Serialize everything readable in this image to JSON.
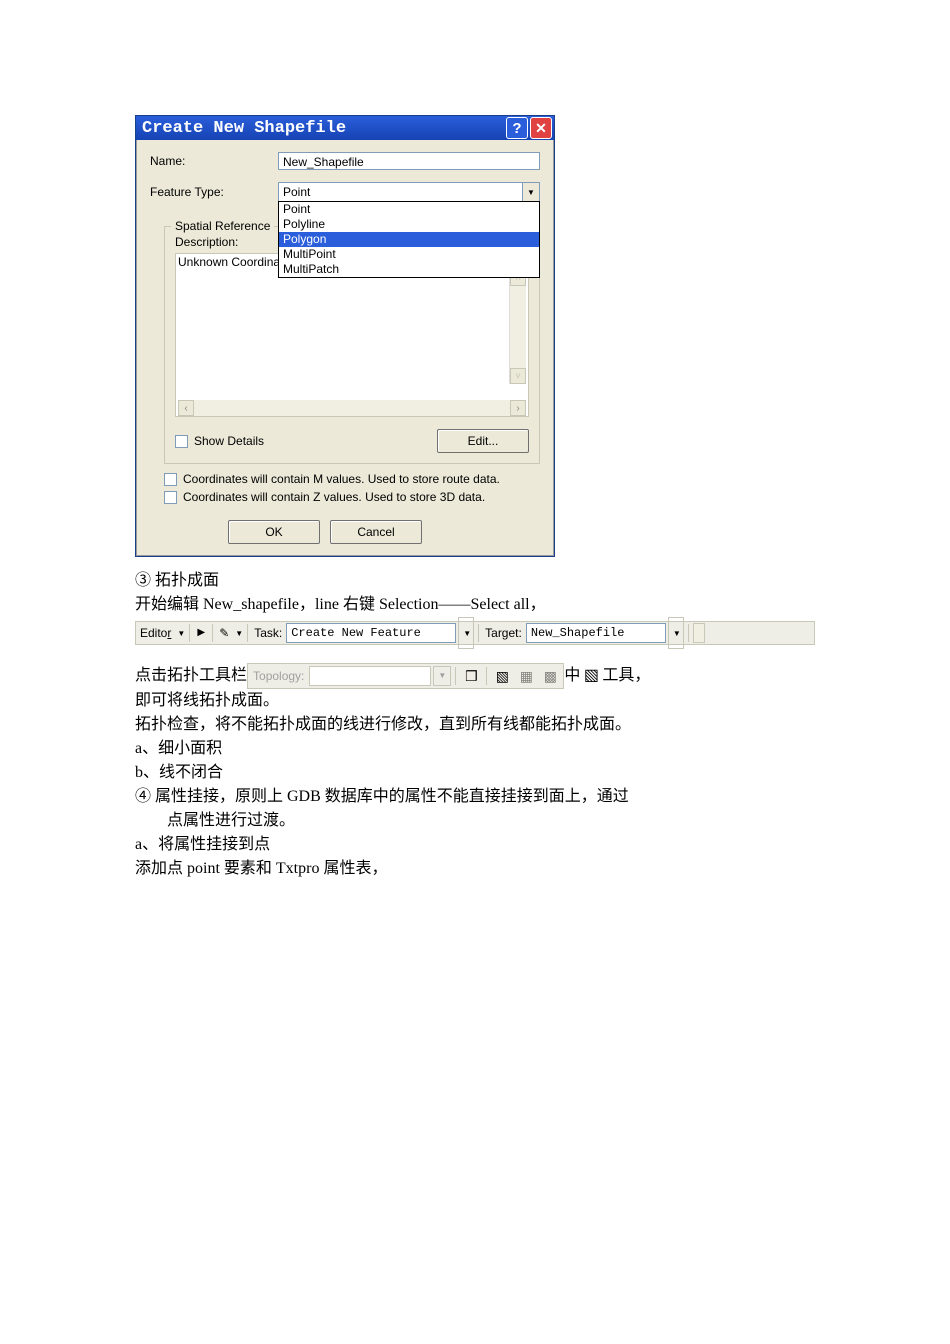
{
  "dialog": {
    "title": "Create New Shapefile",
    "name_label": "Name:",
    "name_value": "New_Shapefile",
    "feature_type_label": "Feature Type:",
    "feature_type_value": "Point",
    "feature_type_options": [
      "Point",
      "Polyline",
      "Polygon",
      "MultiPoint",
      "MultiPatch"
    ],
    "feature_type_selected_index": 2,
    "spatial_ref_legend": "Spatial Reference",
    "description_label": "Description:",
    "description_value": "Unknown Coordinate System",
    "show_details_label": "Show Details",
    "edit_button": "Edit...",
    "mvalues_label": "Coordinates will contain M values. Used to store route data.",
    "zvalues_label": "Coordinates will contain Z values. Used to store 3D data.",
    "ok": "OK",
    "cancel": "Cancel"
  },
  "doc": {
    "l1": "③ 拓扑成面",
    "l2": "开始编辑 New_shapefile，line 右键 Selection——Select all，",
    "l3": "点击拓扑工具栏",
    "l3b": "中",
    "l3c": "工具，",
    "l4": "即可将线拓扑成面。",
    "l5": "拓扑检查，将不能拓扑成面的线进行修改，直到所有线都能拓扑成面。",
    "l6": "a、细小面积",
    "l7": "b、线不闭合",
    "l8": "④ 属性挂接，原则上 GDB 数据库中的属性不能直接挂接到面上，通过",
    "l8b": "点属性进行过渡。",
    "l9": "a、将属性挂接到点",
    "l10": "添加点 point 要素和 Txtpro 属性表，"
  },
  "editor": {
    "menu": "Editor",
    "task_label": "Task:",
    "task_value": "Create New Feature",
    "target_label": "Target:",
    "target_value": "New_Shapefile"
  },
  "topology": {
    "label": "Topology:"
  }
}
